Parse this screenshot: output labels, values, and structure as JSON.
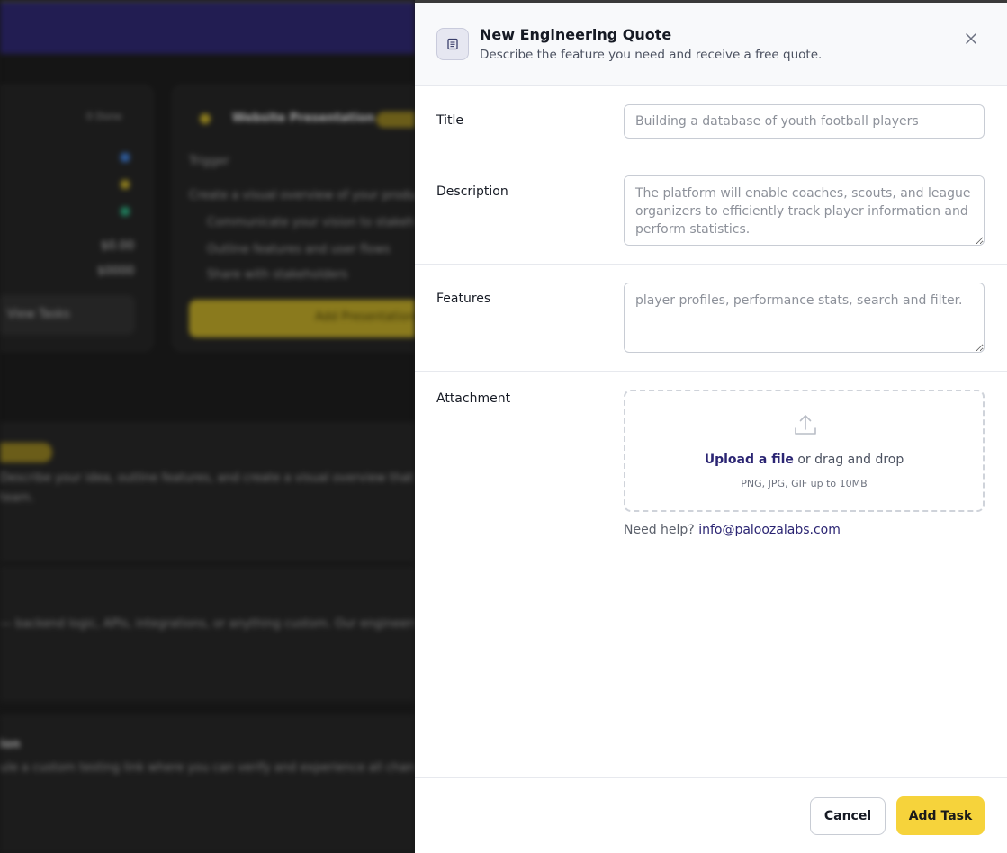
{
  "background": {
    "stat_label": "0 Done",
    "card_title": "Website Presentation",
    "card_sub": "Trigger",
    "card_desc": "Create a visual overview of your product",
    "bullets": [
      "Communicate your vision to stakeholders",
      "Outline features and user flows",
      "Share with stakeholders"
    ],
    "values": [
      "$0.00",
      "$0000"
    ],
    "view_tasks": "View Tasks",
    "add_btn": "Add Presentation",
    "section1_text": "Describe your idea, outline features, and create a visual overview that",
    "section1_text2": "team.",
    "section2_text": "— backend logic, APIs, integrations, or anything custom. Our engineers",
    "section3_title": "ion",
    "section3_text": "ule a custom testing link where you can verify and experience all changes"
  },
  "drawer": {
    "header": {
      "icon": "document-icon",
      "title": "New Engineering Quote",
      "subtitle": "Describe the feature you need and receive a free quote.",
      "close_icon": "close-icon"
    },
    "title_field": {
      "label": "Title",
      "placeholder": "Building a database of youth football players"
    },
    "description_field": {
      "label": "Description",
      "placeholder": "The platform will enable coaches, scouts, and league organizers to efficiently track player information and perform statistics."
    },
    "features_field": {
      "label": "Features",
      "placeholder": "player profiles, performance stats, search and filter."
    },
    "attachment": {
      "label": "Attachment",
      "upload_icon": "upload-icon",
      "upload_link": "Upload a file",
      "upload_rest": " or drag and drop",
      "hint": "PNG, JPG, GIF up to 10MB",
      "help_text": "Need help? ",
      "help_email": "info@paloozalabs.com"
    },
    "footer": {
      "cancel_label": "Cancel",
      "add_label": "Add Task"
    }
  },
  "colors": {
    "accent_yellow": "#f6d33b",
    "link_indigo": "#2b2573",
    "header_bg": "#221d52"
  }
}
